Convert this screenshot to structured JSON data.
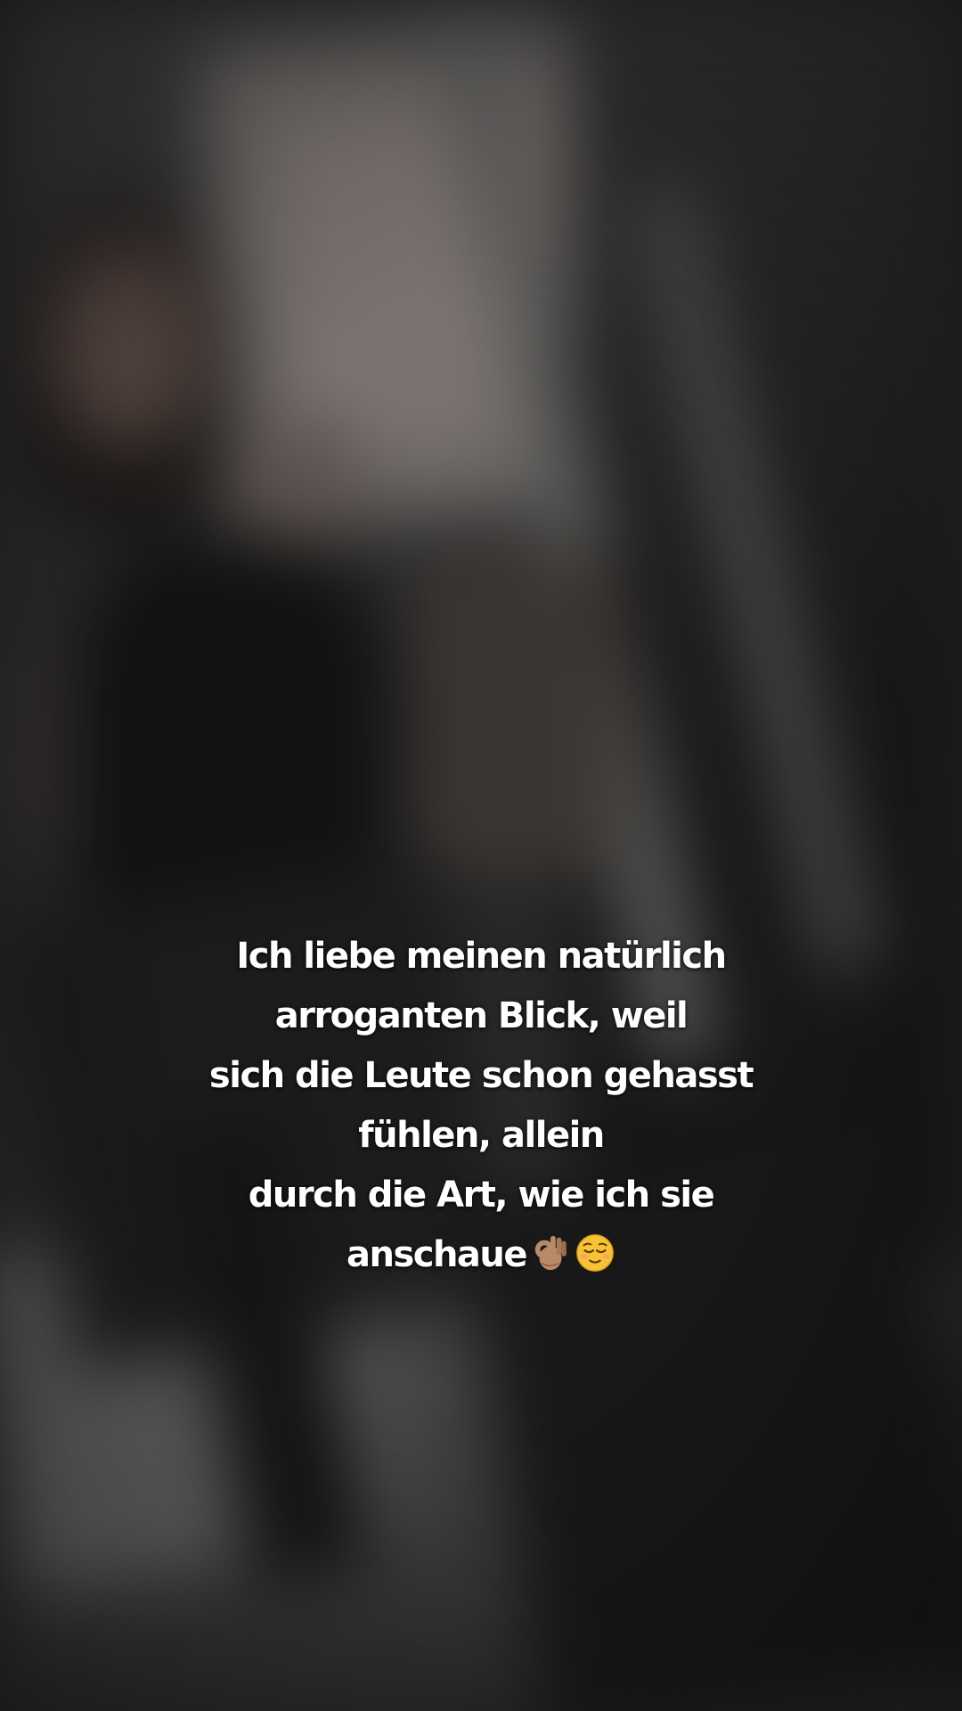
{
  "caption": {
    "lines": [
      "Ich liebe meinen natürlich",
      "arroganten Blick, weil",
      "sich die Leute schon gehasst",
      "fühlen, allein",
      "durch die Art, wie ich sie",
      "anschaue"
    ],
    "emojis": [
      "ok-hand-icon",
      "relieved-face-icon"
    ],
    "color": "#ffffff"
  }
}
